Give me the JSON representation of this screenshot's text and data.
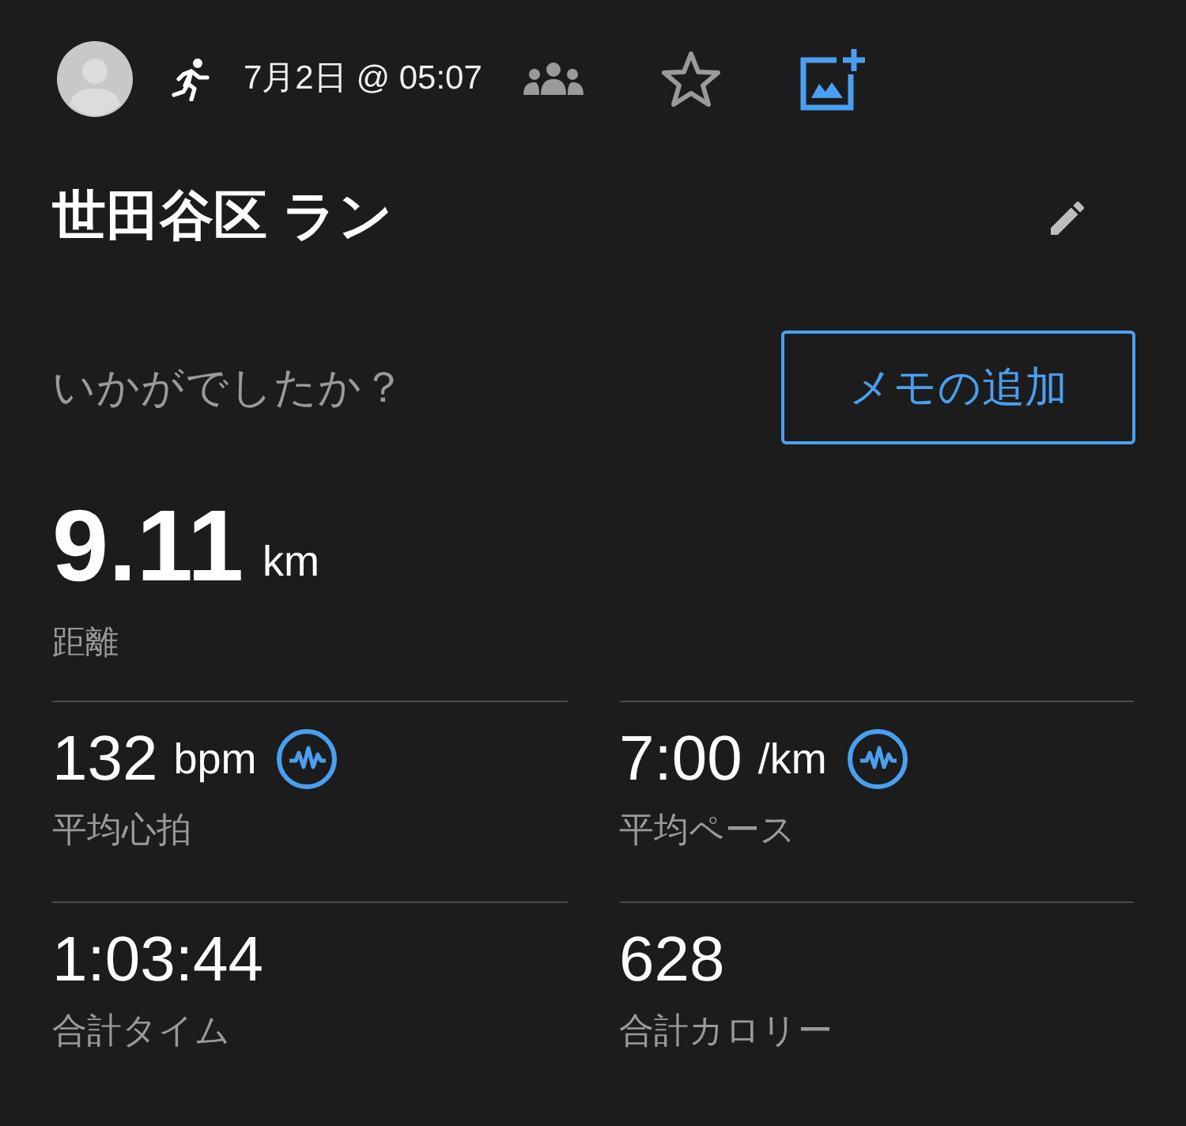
{
  "header": {
    "date": "7月2日 @ 05:07"
  },
  "title": "世田谷区 ラン",
  "prompt": "いかがでしたか？",
  "add_note_button": "メモの追加",
  "distance": {
    "value": "9.11",
    "unit": "km",
    "label": "距離"
  },
  "stats": [
    {
      "value": "132",
      "unit": "bpm",
      "label": "平均心拍",
      "chart_icon": true
    },
    {
      "value": "7:00",
      "unit": "/km",
      "label": "平均ペース",
      "chart_icon": true
    },
    {
      "value": "1:03:44",
      "label": "合計タイム",
      "chart_icon": false
    },
    {
      "value": "628",
      "label": "合計カロリー",
      "chart_icon": false
    }
  ]
}
